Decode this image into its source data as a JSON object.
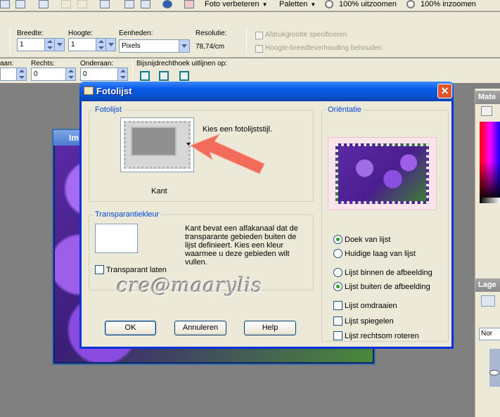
{
  "toolbar": {
    "menu_foto": "Foto verbeteren",
    "menu_paletten": "Paletten",
    "zoom_out": "100% uitzoomen",
    "zoom_in": "100% inzoomen"
  },
  "options": {
    "breedte_label": "Breedte:",
    "breedte_value": "1",
    "hoogte_label": "Hoogte:",
    "hoogte_value": "1",
    "eenheden_label": "Eenheden:",
    "eenheden_value": "Pixels",
    "resolutie_label": "Resolutie:",
    "resolutie_value": "78,74/cm",
    "afdruk_label": "Afdrukgrootte specificeren",
    "verhouding_label": "Hoogte-breedteverhouding behouden",
    "links_label": "aan:",
    "rechts_label": "Rechts:",
    "rechts_value": "0",
    "onderaan_label": "Onderaan:",
    "onderaan_value": "0",
    "bijsnij_label": "Bijsnijdrechthoek uitlijnen op:"
  },
  "image_window": {
    "title": "Im"
  },
  "right_panel": {
    "materials_title": "Mate",
    "layers_title": "Lage",
    "layers_tab": "Nor"
  },
  "dialog": {
    "title": "Fotolijst",
    "frame_group": "Fotolijst",
    "frame_hint": "Kies een fotolijststijl.",
    "frame_name": "Kant",
    "transparency_group": "Transparantiekleur",
    "transparency_text": "Kant bevat een alfakanaal dat de transparante gebieden buiten de lijst definieert.  Kies een kleur waarmee u deze gebieden wilt vullen.",
    "transparent_label": "Transparant laten",
    "orientation_group": "Oriëntatie",
    "option_canvas": "Doek van lijst",
    "option_layer": "Huidige laag van lijst",
    "option_inside": "Lijst binnen de afbeelding",
    "option_outside": "Lijst buiten de afbeelding",
    "option_flip": "Lijst omdraaien",
    "option_mirror": "Lijst spiegelen",
    "option_rotate": "Lijst rechtsom roteren",
    "ok": "OK",
    "cancel": "Annuleren",
    "help": "Help",
    "close": "✕"
  },
  "watermark": "cre@maarylis"
}
